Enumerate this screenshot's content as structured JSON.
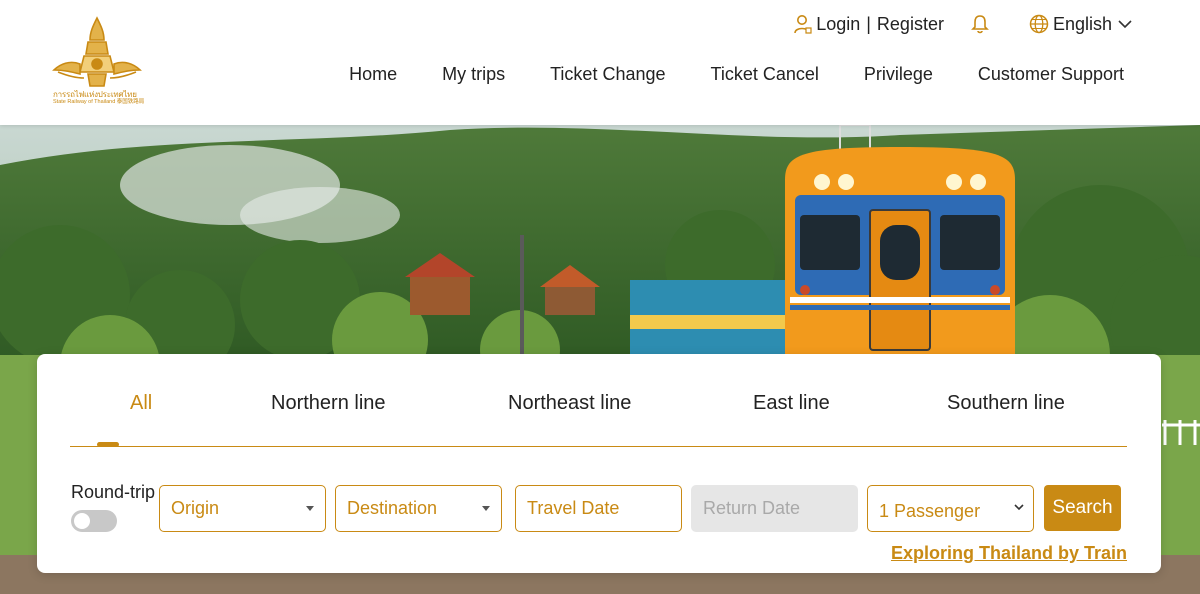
{
  "brand": {
    "name_th": "การรถไฟแห่งประเทศไทย",
    "name_en": "State Railway of Thailand 泰国铁路局",
    "accent_color": "#c98a14"
  },
  "topbar": {
    "login_label": "Login",
    "separator": "|",
    "register_label": "Register",
    "language_label": "English",
    "icons": [
      "user-icon",
      "bell-icon",
      "globe-icon",
      "chevron-down-icon"
    ]
  },
  "nav": {
    "items": [
      {
        "label": "Home"
      },
      {
        "label": "My trips"
      },
      {
        "label": "Ticket Change"
      },
      {
        "label": "Ticket Cancel"
      },
      {
        "label": "Privilege"
      },
      {
        "label": "Customer Support"
      }
    ]
  },
  "search": {
    "tabs": [
      {
        "label": "All",
        "active": true
      },
      {
        "label": "Northern line",
        "active": false
      },
      {
        "label": "Northeast line",
        "active": false
      },
      {
        "label": "East line",
        "active": false
      },
      {
        "label": "Southern line",
        "active": false
      }
    ],
    "round_trip_label": "Round-trip",
    "round_trip_enabled": false,
    "origin_placeholder": "Origin",
    "destination_placeholder": "Destination",
    "travel_date_placeholder": "Travel Date",
    "return_date_placeholder": "Return Date",
    "passenger_value": "1 Passenger",
    "search_label": "Search",
    "explore_link": "Exploring Thailand by Train"
  }
}
